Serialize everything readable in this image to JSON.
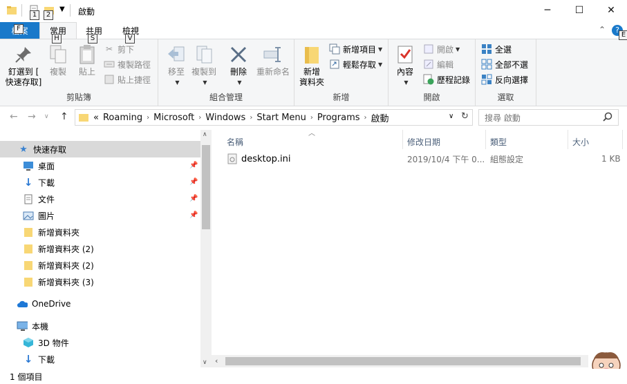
{
  "window": {
    "title": "啟動",
    "minimize_glyph": "─",
    "maximize_glyph": "☐",
    "close_glyph": "✕"
  },
  "keytips": {
    "qat1": "1",
    "qat2": "2",
    "file": "F",
    "home": "H",
    "share": "S",
    "view": "V",
    "help": "E"
  },
  "tabs": {
    "file": "檔案",
    "home": "常用",
    "share": "共用",
    "view": "檢視",
    "collapse_glyph": "⌃",
    "help_glyph": "?"
  },
  "ribbon": {
    "clipboard": {
      "label": "剪貼簿",
      "pin_line1": "釘選到 [",
      "pin_line2": "快速存取]",
      "copy": "複製",
      "paste": "貼上",
      "cut": "剪下",
      "copy_path": "複製路徑",
      "paste_shortcut": "貼上捷徑"
    },
    "organize": {
      "label": "組合管理",
      "move_to": "移至",
      "copy_to": "複製到",
      "delete": "刪除",
      "rename": "重新命名"
    },
    "new": {
      "label": "新增",
      "new_folder_line1": "新增",
      "new_folder_line2": "資料夾",
      "new_item": "新增項目",
      "easy_access": "輕鬆存取"
    },
    "open": {
      "label": "開啟",
      "properties": "內容",
      "open": "開啟",
      "edit": "編輯",
      "history": "歷程記錄"
    },
    "select": {
      "label": "選取",
      "select_all": "全選",
      "select_none": "全部不選",
      "invert": "反向選擇"
    }
  },
  "address": {
    "prefix": "«",
    "crumbs": [
      "Roaming",
      "Microsoft",
      "Windows",
      "Start Menu",
      "Programs",
      "啟動"
    ],
    "search_placeholder": "搜尋 啟動"
  },
  "nav": {
    "quick_access": "快速存取",
    "items": [
      "桌面",
      "下載",
      "文件",
      "圖片",
      "新增資料夾",
      "新增資料夾 (2)",
      "新增資料夾 (2)",
      "新增資料夾 (3)"
    ],
    "onedrive": "OneDrive",
    "this_pc": "本機",
    "objects3d": "3D 物件",
    "downloads": "下載"
  },
  "columns": {
    "name": "名稱",
    "date": "修改日期",
    "type": "類型",
    "size": "大小"
  },
  "files": [
    {
      "name": "desktop.ini",
      "date": "2019/10/4 下午 0...",
      "type": "組態設定",
      "size": "1 KB"
    }
  ],
  "status": {
    "count": "1 個項目"
  },
  "colors": {
    "accent": "#1979ca",
    "selection": "#cce8ff",
    "folder": "#f8d775"
  }
}
